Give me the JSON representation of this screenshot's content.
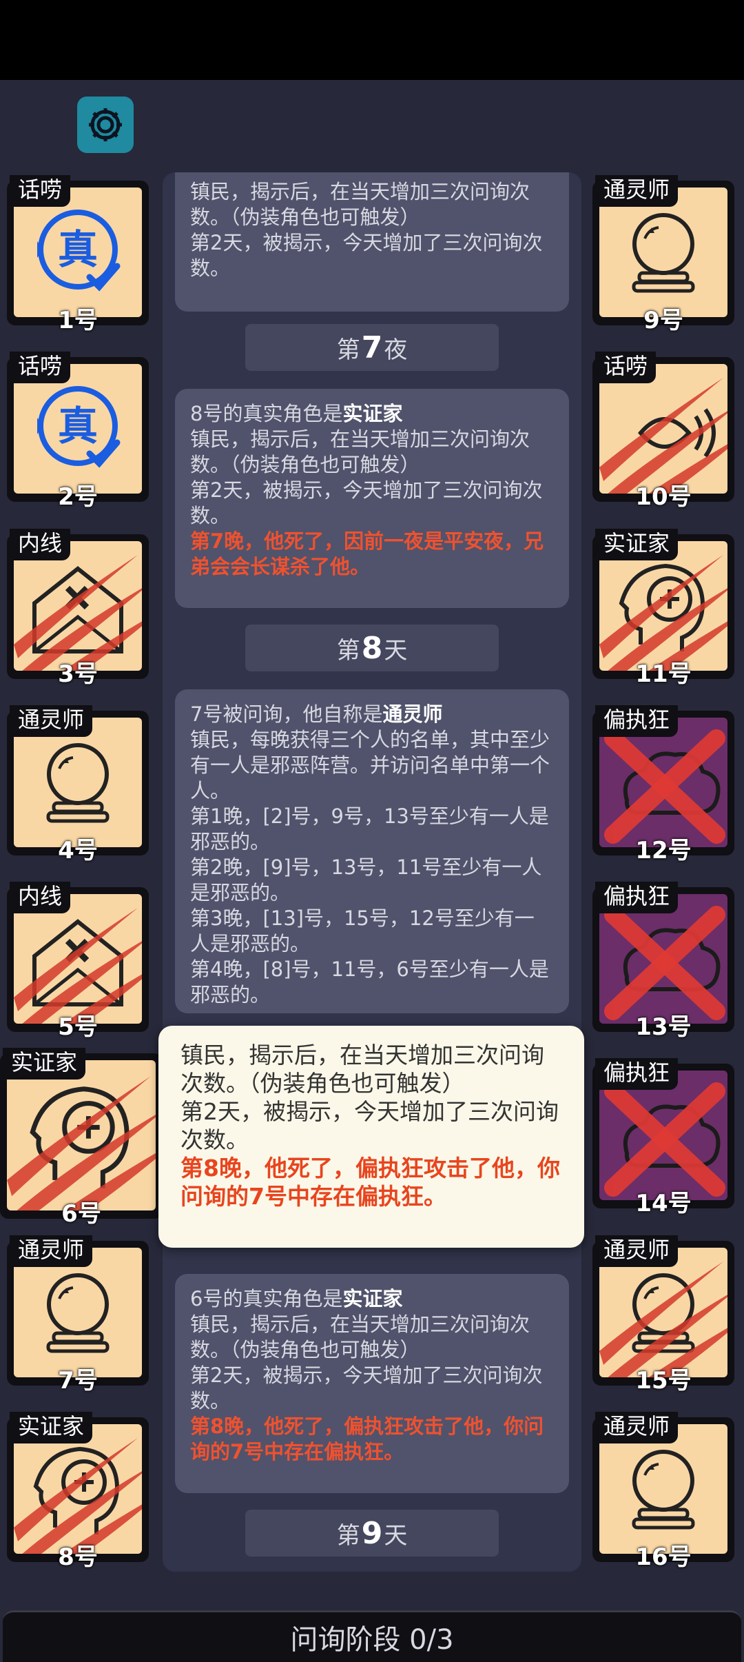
{
  "settings": {
    "icon": "gear-icon"
  },
  "log": {
    "card1": {
      "line1": "镇民，揭示后，在当天增加三次问询次数。（伪装角色也可触发）",
      "line2": "第2天，被揭示，今天增加了三次问询次数。"
    },
    "header_night7": {
      "prefix": "第",
      "num": "7",
      "suffix": "夜"
    },
    "card2": {
      "title_prefix": "8号的真实角色是",
      "title_role": "实证家",
      "line1": "镇民，揭示后，在当天增加三次问询次数。（伪装角色也可触发）",
      "line2": "第2天，被揭示，今天增加了三次问询次数。",
      "red": "第7晚，他死了，因前一夜是平安夜，兄弟会会长谋杀了他。"
    },
    "header_day8": {
      "prefix": "第",
      "num": "8",
      "suffix": "天"
    },
    "card3": {
      "title_prefix": "7号被问询，他自称是",
      "title_role": "通灵师",
      "line1": "镇民，每晚获得三个人的名单，其中至少有一人是邪恶阵营。并访问名单中第一个人。",
      "line2": "第1晚，[2]号，9号，13号至少有一人是邪恶的。",
      "line3": "第2晚，[9]号，13号，11号至少有一人是邪恶的。",
      "line4": "第3晚，[13]号，15号，12号至少有一人是邪恶的。",
      "line5": "第4晚，[8]号，11号，6号至少有一人是邪恶的。"
    },
    "card4": {
      "title_prefix": "6号的真实角色是",
      "title_role": "实证家",
      "line1": "镇民，揭示后，在当天增加三次问询次数。（伪装角色也可触发）",
      "line2": "第2天，被揭示，今天增加了三次问询次数。",
      "red": "第8晚，他死了，偏执狂攻击了他，你问询的7号中存在偏执狂。"
    },
    "header_day9": {
      "prefix": "第",
      "num": "9",
      "suffix": "天"
    }
  },
  "popup": {
    "line1": "镇民，揭示后，在当天增加三次问询次数。（伪装角色也可触发）",
    "line2": "第2天，被揭示，今天增加了三次问询次数。",
    "red": "第8晚，他死了，偏执狂攻击了他，你问询的7号中存在偏执狂。"
  },
  "players_left": [
    {
      "num": "1号",
      "role": "话唠",
      "icon": "truth-speech-icon",
      "dead": false
    },
    {
      "num": "2号",
      "role": "话唠",
      "icon": "truth-speech-icon",
      "dead": false
    },
    {
      "num": "3号",
      "role": "内线",
      "icon": "envelope-x-icon",
      "dead": true
    },
    {
      "num": "4号",
      "role": "通灵师",
      "icon": "crystal-ball-icon",
      "dead": false
    },
    {
      "num": "5号",
      "role": "内线",
      "icon": "envelope-x-icon",
      "dead": true
    },
    {
      "num": "6号",
      "role": "实证家",
      "icon": "head-plus-icon",
      "dead": true
    },
    {
      "num": "7号",
      "role": "通灵师",
      "icon": "crystal-ball-icon",
      "dead": false
    },
    {
      "num": "8号",
      "role": "实证家",
      "icon": "head-plus-icon",
      "dead": true
    }
  ],
  "players_right": [
    {
      "num": "9号",
      "role": "通灵师",
      "icon": "crystal-ball-icon",
      "dead": false
    },
    {
      "num": "10号",
      "role": "话唠",
      "icon": "speech-waves-icon",
      "dead": true
    },
    {
      "num": "11号",
      "role": "实证家",
      "icon": "head-plus-icon",
      "dead": true
    },
    {
      "num": "12号",
      "role": "偏执狂",
      "icon": "cloud-x-icon",
      "dead": true
    },
    {
      "num": "13号",
      "role": "偏执狂",
      "icon": "cloud-x-icon",
      "dead": true
    },
    {
      "num": "14号",
      "role": "偏执狂",
      "icon": "cloud-x-icon",
      "dead": true
    },
    {
      "num": "15号",
      "role": "通灵师",
      "icon": "crystal-ball-icon",
      "dead": true
    },
    {
      "num": "16号",
      "role": "通灵师",
      "icon": "crystal-ball-icon",
      "dead": false
    }
  ],
  "bottom_bar": {
    "label": "问询阶段 0/3"
  }
}
